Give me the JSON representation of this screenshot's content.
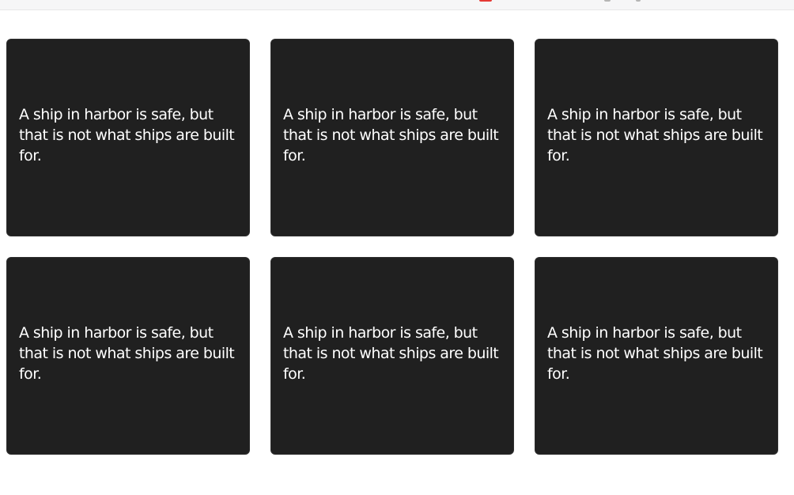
{
  "cards": [
    {
      "text": "A ship in harbor is safe, but that is not what ships are built for."
    },
    {
      "text": "A ship in harbor is safe, but that is not what ships are built for."
    },
    {
      "text": "A ship in harbor is safe, but that is not what ships are built for."
    },
    {
      "text": "A ship in harbor is safe, but that is not what ships are built for."
    },
    {
      "text": "A ship in harbor is safe, but that is not what ships are built for."
    },
    {
      "text": "A ship in harbor is safe, but that is not what ships are built for."
    }
  ],
  "colors": {
    "page_background": "#ffffff",
    "card_background": "#202020",
    "card_text": "#ffffff",
    "topbar_background": "#f6f6f7",
    "topbar_accent": "#e53935"
  }
}
